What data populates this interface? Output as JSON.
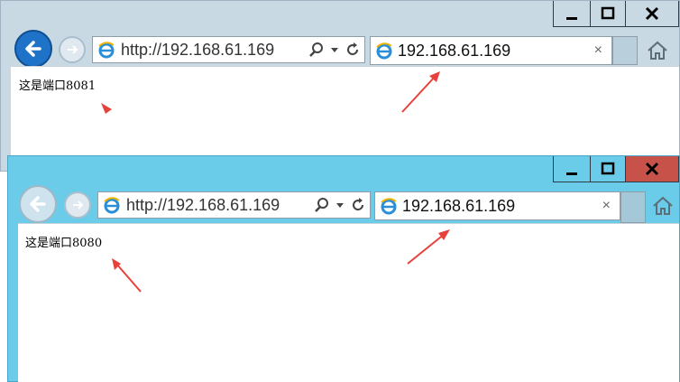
{
  "back_window": {
    "address_url": "http://192.168.61.169",
    "tab_title": "192.168.61.169",
    "tab_close": "×",
    "page_text": "这是端口8081"
  },
  "front_window": {
    "address_url": "http://192.168.61.169",
    "tab_title": "192.168.61.169",
    "tab_close": "×",
    "page_text": "这是端口8080"
  },
  "icons": [
    "minimize-icon",
    "maximize-icon",
    "close-icon",
    "back-arrow-icon",
    "forward-arrow-icon",
    "ie-logo-icon",
    "search-icon",
    "dropdown-icon",
    "refresh-icon",
    "home-icon"
  ],
  "colors": {
    "annotation_arrow": "#e8413b",
    "front_frame": "#6acce9",
    "back_frame": "#c9d9e3",
    "close_button_active": "#c7524a",
    "back_button_active": "#1e73c8"
  }
}
